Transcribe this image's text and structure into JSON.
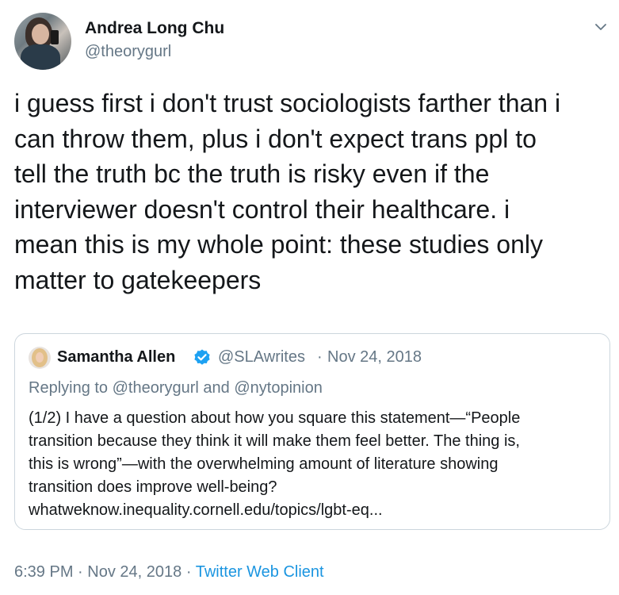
{
  "author": {
    "display_name": "Andrea Long Chu",
    "handle": "@theorygurl"
  },
  "tweet": {
    "text": "i guess first i don't trust sociologists farther than i\ncan throw them, plus i don't expect trans ppl to\ntell the truth bc the truth is risky even if the\ninterviewer doesn't control their healthcare. i\nmean this is my whole point: these studies only\nmatter to gatekeepers"
  },
  "quoted_tweet": {
    "display_name": "Samantha Allen",
    "handle": "@SLAwrites",
    "separator": "·",
    "date": "Nov 24, 2018",
    "replying_to": "Replying to @theorygurl and @nytopinion",
    "text": "(1/2) I have a question about how you square this statement—“People\ntransition because they think it will make them feel better. The thing is,\nthis is wrong”—with the overwhelming amount of literature showing\ntransition does improve well-being?\nwhatweknow.inequality.cornell.edu/topics/lgbt-eq..."
  },
  "meta": {
    "time": "6:39 PM",
    "sep1": "·",
    "date": "Nov 24, 2018",
    "sep2": "·",
    "client": "Twitter Web Client"
  },
  "icons": {
    "more": "chevron-down-icon",
    "verified": "verified-badge-icon"
  },
  "colors": {
    "text": "#14171a",
    "secondary": "#657786",
    "link": "#1b95e0",
    "border": "#ccd6dd"
  }
}
